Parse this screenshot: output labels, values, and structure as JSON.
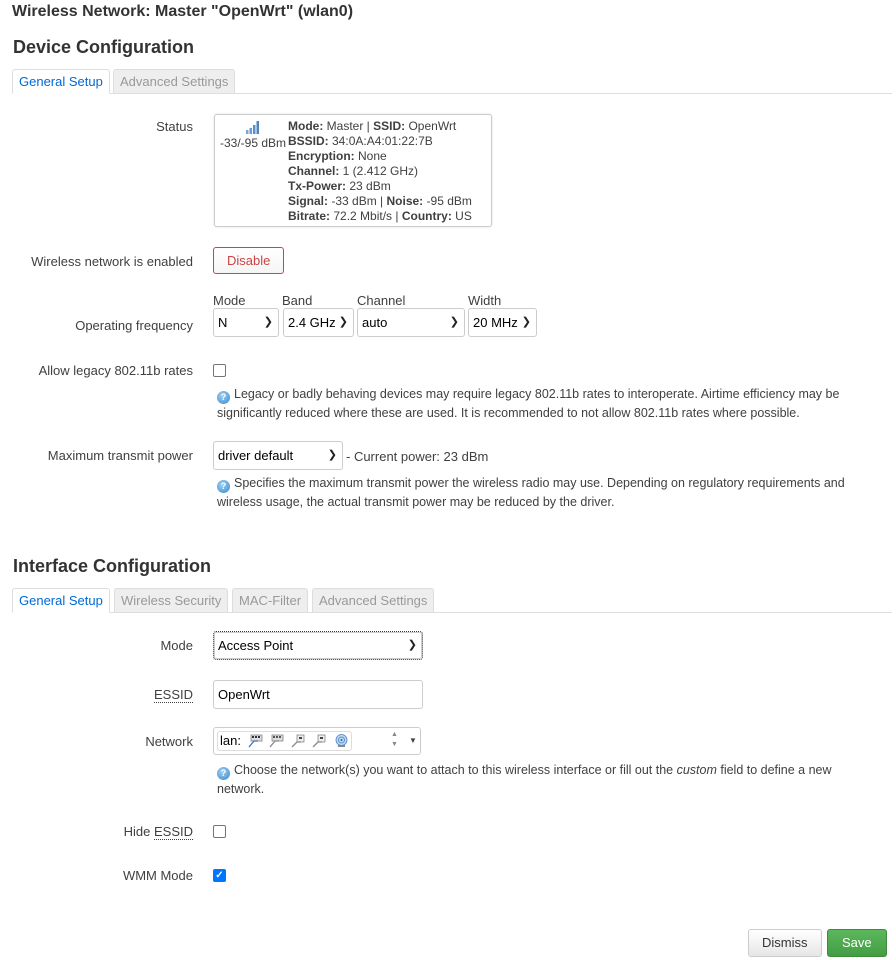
{
  "page_title": "Wireless Network: Master \"OpenWrt\" (wlan0)",
  "device_config": {
    "heading": "Device Configuration",
    "tabs": [
      {
        "label": "General Setup",
        "active": true
      },
      {
        "label": "Advanced Settings",
        "active": false
      }
    ],
    "status": {
      "label": "Status",
      "signal_text": "-33/-95 dBm",
      "signal_icon": "signal-bars-icon",
      "lines": [
        [
          {
            "k": "Mode:",
            "v": " Master | "
          },
          {
            "k": "SSID:",
            "v": " OpenWrt"
          }
        ],
        [
          {
            "k": "BSSID:",
            "v": " 34:0A:A4:01:22:7B"
          }
        ],
        [
          {
            "k": "Encryption:",
            "v": " None"
          }
        ],
        [
          {
            "k": "Channel:",
            "v": " 1 (2.412 GHz)"
          }
        ],
        [
          {
            "k": "Tx-Power:",
            "v": " 23 dBm"
          }
        ],
        [
          {
            "k": "Signal:",
            "v": " -33 dBm | "
          },
          {
            "k": "Noise:",
            "v": " -95 dBm"
          }
        ],
        [
          {
            "k": "Bitrate:",
            "v": " 72.2 Mbit/s | "
          },
          {
            "k": "Country:",
            "v": " US"
          }
        ]
      ]
    },
    "enabled": {
      "label": "Wireless network is enabled",
      "button": "Disable"
    },
    "frequency": {
      "label": "Operating frequency",
      "mode": {
        "label": "Mode",
        "value": "N"
      },
      "band": {
        "label": "Band",
        "value": "2.4 GHz"
      },
      "channel": {
        "label": "Channel",
        "value": "auto"
      },
      "width": {
        "label": "Width",
        "value": "20 MHz"
      }
    },
    "legacy": {
      "label": "Allow legacy 802.11b rates",
      "checked": false,
      "help": "Legacy or badly behaving devices may require legacy 802.11b rates to interoperate. Airtime efficiency may be significantly reduced where these are used. It is recommended to not allow 802.11b rates where possible."
    },
    "txpower": {
      "label": "Maximum transmit power",
      "value": "driver default",
      "current": "- Current power: 23 dBm",
      "help": "Specifies the maximum transmit power the wireless radio may use. Depending on regulatory requirements and wireless usage, the actual transmit power may be reduced by the driver."
    }
  },
  "iface_config": {
    "heading": "Interface Configuration",
    "tabs": [
      {
        "label": "General Setup",
        "active": true
      },
      {
        "label": "Wireless Security",
        "active": false
      },
      {
        "label": "MAC-Filter",
        "active": false
      },
      {
        "label": "Advanced Settings",
        "active": false
      }
    ],
    "mode": {
      "label": "Mode",
      "value": "Access Point"
    },
    "essid": {
      "label": "ESSID",
      "value": "OpenWrt"
    },
    "network": {
      "label": "Network",
      "value_prefix": "lan:",
      "icons": [
        "ethernet-port-icon",
        "ethernet-port-icon",
        "ethernet-port-icon",
        "ethernet-port-icon",
        "wifi-icon"
      ],
      "help_pre": "Choose the network(s) you want to attach to this wireless interface or fill out the ",
      "help_em": "custom",
      "help_post": " field to define a new network."
    },
    "hide_essid": {
      "label_pre": "Hide ",
      "label_abbr": "ESSID",
      "checked": false
    },
    "wmm": {
      "label": "WMM Mode",
      "checked": true
    }
  },
  "footer": {
    "dismiss": "Dismiss",
    "save": "Save"
  },
  "colors": {
    "accent": "#0069d6",
    "danger": "#cc4444",
    "save": "#449d44"
  }
}
